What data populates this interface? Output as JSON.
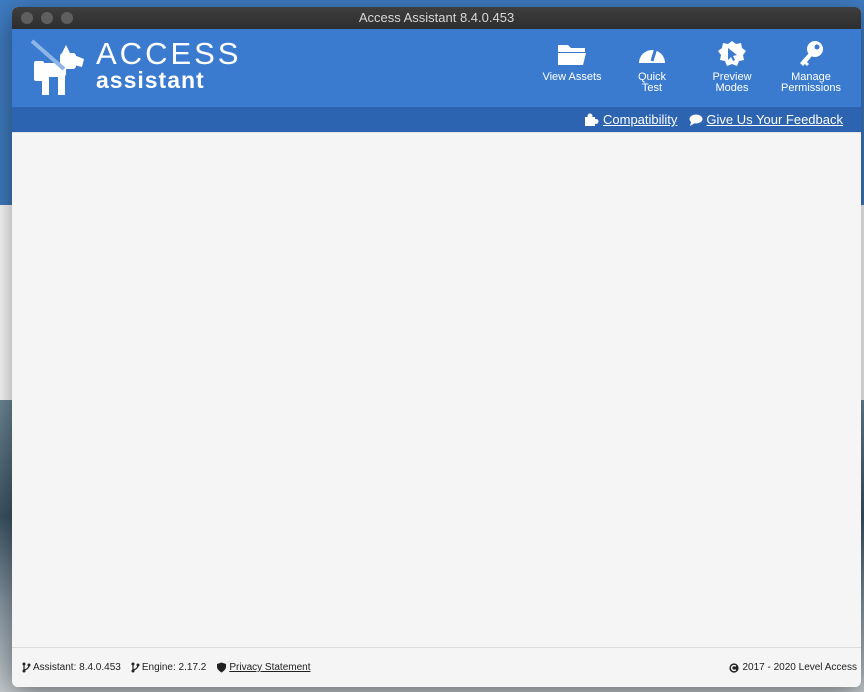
{
  "window": {
    "title": "Access Assistant 8.4.0.453"
  },
  "logo": {
    "line1": "ACCESS",
    "line2": "assistant"
  },
  "toolbar": [
    {
      "label": "View Assets",
      "icon": "folder-icon"
    },
    {
      "label": "Quick\nTest",
      "icon": "speedometer-icon"
    },
    {
      "label": "Preview\nModes",
      "icon": "cursor-badge-icon"
    },
    {
      "label": "Manage\nPermissions",
      "icon": "key-icon"
    }
  ],
  "subbar": {
    "compatibility": "Compatibility",
    "feedback": "Give Us Your Feedback"
  },
  "footer": {
    "assistant": "Assistant: 8.4.0.453",
    "engine": "Engine: 2.17.2",
    "privacy": "Privacy Statement",
    "copyright": "2017 - 2020 Level Access"
  },
  "colors": {
    "header": "#3a7bd0",
    "subbar": "#2c64b2",
    "titlebar": "#333333"
  }
}
